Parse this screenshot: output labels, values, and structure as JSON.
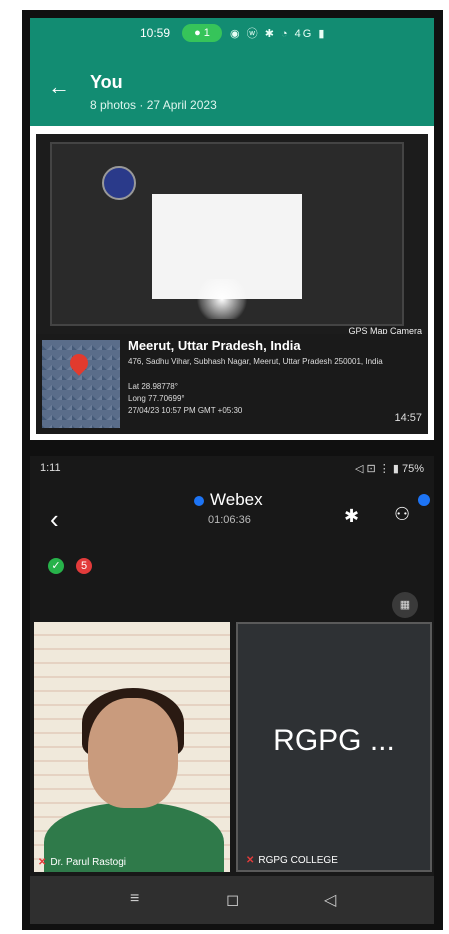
{
  "whatsapp": {
    "status_time": "10:59",
    "status_pill": "● 1",
    "status_icons": "◉ ⓦ ✱ ◔ 4G ▮",
    "title": "You",
    "subtitle": "8 photos · 27 April 2023",
    "back_icon": "arrow-left-icon"
  },
  "photo": {
    "gps_camera_label": "GPS Map Camera",
    "place": "Meerut, Uttar Pradesh, India",
    "address": "476, Sadhu Vihar, Subhash Nagar, Meerut, Uttar Pradesh 250001, India",
    "lat": "Lat 28.98778°",
    "long": "Long 77.70699°",
    "datetime": "27/04/23 10:57 PM GMT +05:30",
    "time": "14:57"
  },
  "webex": {
    "status_time": "1:11",
    "status_right": "◁ ⊡ ⋮ ▮ 75%",
    "title": "Webex",
    "meeting_clock": "01:06:36",
    "participants": [
      {
        "name": "Dr. Parul Rastogi",
        "initials": ""
      },
      {
        "name": "RGPG COLLEGE",
        "initials": "RGPG ..."
      }
    ],
    "badge_ok": "✓",
    "badge_alert": "5"
  },
  "nav": {
    "recent": "≡",
    "home": "◻",
    "back": "◁"
  },
  "colors": {
    "whatsapp_green": "#128c72",
    "webex_blue": "#1d74f5"
  }
}
